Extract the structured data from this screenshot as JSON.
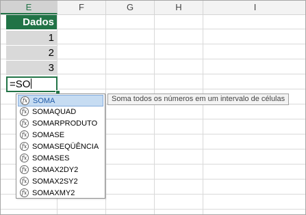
{
  "columns": [
    {
      "label": "E",
      "active": true
    },
    {
      "label": "F",
      "active": false
    },
    {
      "label": "G",
      "active": false
    },
    {
      "label": "H",
      "active": false
    },
    {
      "label": "I",
      "active": false
    }
  ],
  "table": {
    "header": "Dados",
    "values": [
      "1",
      "2",
      "3"
    ]
  },
  "formula_cell": {
    "value": "=SO"
  },
  "autocomplete": {
    "icon": "function-icon",
    "items": [
      "SOMA",
      "SOMAQUAD",
      "SOMARPRODUTO",
      "SOMASE",
      "SOMASEQÜÊNCIA",
      "SOMASES",
      "SOMAX2DY2",
      "SOMAX2SY2",
      "SOMAXMY2"
    ],
    "selected_index": 0
  },
  "tooltip": {
    "text": "Soma todos os números em um intervalo de células"
  },
  "colors": {
    "accent": "#217346",
    "selected_bg": "#c6dcf2",
    "selected_text": "#1e5aa8"
  }
}
